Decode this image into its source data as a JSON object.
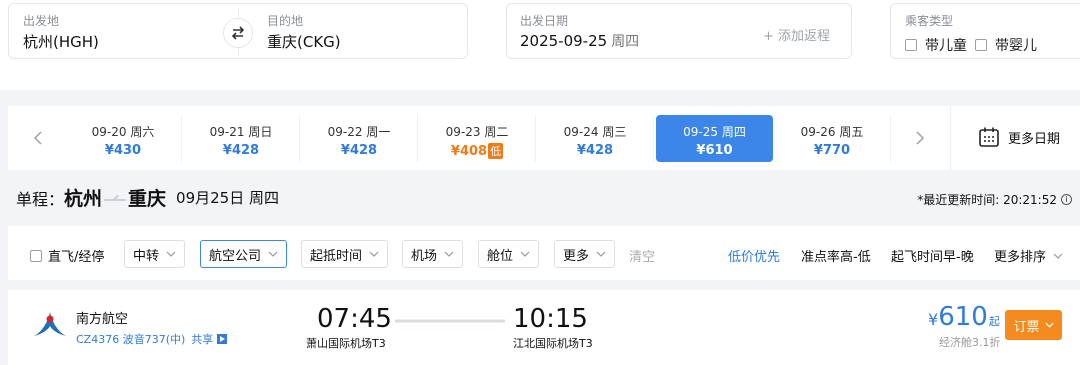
{
  "search": {
    "from_label": "出发地",
    "from_value": "杭州(HGH)",
    "to_label": "目的地",
    "to_value": "重庆(CKG)",
    "date_label": "出发日期",
    "date_value": "2025-09-25",
    "date_weekday": "周四",
    "add_return": "+ 添加返程",
    "passenger_label": "乘客类型",
    "child_option": "带儿童",
    "infant_option": "带婴儿"
  },
  "date_strip": {
    "days": [
      {
        "date": "09-20",
        "weekday": "周六",
        "price": "¥430"
      },
      {
        "date": "09-21",
        "weekday": "周日",
        "price": "¥428"
      },
      {
        "date": "09-22",
        "weekday": "周一",
        "price": "¥428"
      },
      {
        "date": "09-23",
        "weekday": "周二",
        "price": "¥408",
        "tag": "低"
      },
      {
        "date": "09-24",
        "weekday": "周三",
        "price": "¥428"
      },
      {
        "date": "09-25",
        "weekday": "周四",
        "price": "¥610"
      },
      {
        "date": "09-26",
        "weekday": "周五",
        "price": "¥770"
      }
    ],
    "more_dates": "更多日期"
  },
  "summary": {
    "trip_type": "单程：",
    "from_city": "杭州",
    "to_city": "重庆",
    "date": "09月25日 周四",
    "update_label": "*最近更新时间: 20:21:52",
    "info": "i"
  },
  "filters": {
    "direct": "直飞/经停",
    "transfer": "中转",
    "airline": "航空公司",
    "time": "起抵时间",
    "airport": "机场",
    "cabin": "舱位",
    "more": "更多",
    "clear": "清空",
    "sort_low_price": "低价优先",
    "sort_punctuality": "准点率高-低",
    "sort_departure": "起飞时间早-晚",
    "sort_more": "更多排序"
  },
  "flight": {
    "airline": "南方航空",
    "flight_no": "CZ4376 波音737(中)",
    "share": "共享",
    "dep_time": "07:45",
    "dep_airport": "萧山国际机场T3",
    "arr_time": "10:15",
    "arr_airport": "江北国际机场T3",
    "price_currency": "¥",
    "price": "610",
    "price_suffix": "起",
    "cabin_info": "经济舱3.1折",
    "book": "订票"
  },
  "colors": {
    "accent": "#3b86e8",
    "price_blue": "#2f7be0",
    "low_orange": "#f07b16",
    "book_orange": "#f38b1e"
  }
}
